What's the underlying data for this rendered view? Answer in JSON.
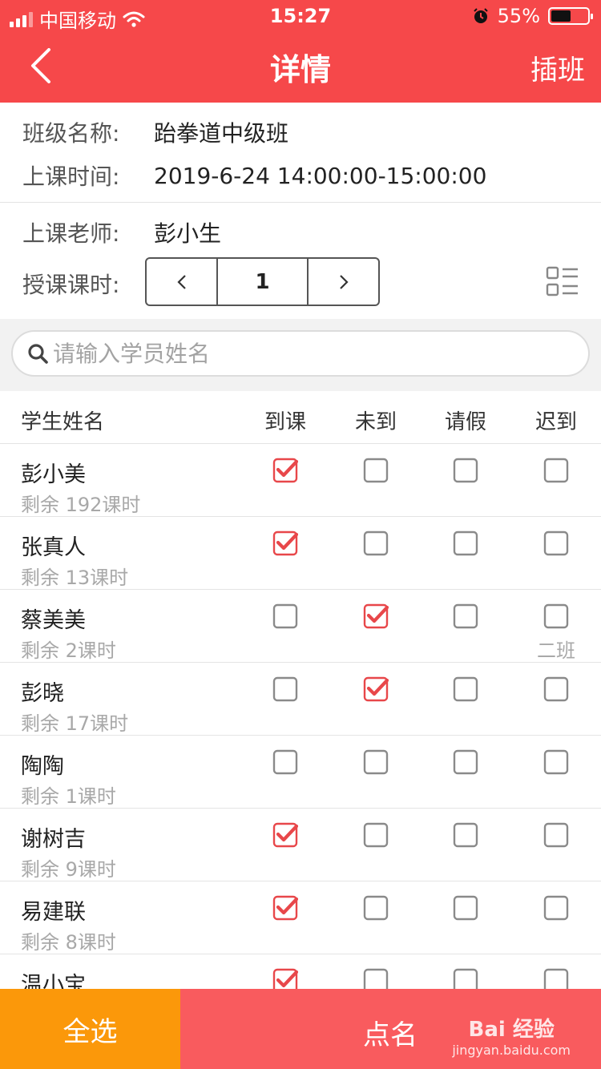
{
  "status_bar": {
    "carrier": "中国移动",
    "time": "15:27",
    "battery_percent": "55%",
    "battery_level": 0.55
  },
  "nav": {
    "title": "详情",
    "action": "插班"
  },
  "info": {
    "class_label": "班级名称:",
    "class_value": "跆拳道中级班",
    "time_label": "上课时间:",
    "time_value": "2019-6-24 14:00:00-15:00:00",
    "teacher_label": "上课老师:",
    "teacher_value": "彭小生",
    "hours_label": "授课课时:",
    "hours_value": "1"
  },
  "search": {
    "placeholder": "请输入学员姓名"
  },
  "table": {
    "headers": {
      "name": "学生姓名",
      "present": "到课",
      "absent": "未到",
      "leave": "请假",
      "late": "迟到"
    },
    "rows": [
      {
        "name": "彭小美",
        "remain": "剩余 192课时",
        "checked": "present"
      },
      {
        "name": "张真人",
        "remain": "剩余 13课时",
        "checked": "present"
      },
      {
        "name": "蔡美美",
        "remain": "剩余 2课时",
        "checked": "absent",
        "note": "二班"
      },
      {
        "name": "彭晓",
        "remain": "剩余 17课时",
        "checked": "absent"
      },
      {
        "name": "陶陶",
        "remain": "剩余 1课时",
        "checked": ""
      },
      {
        "name": "谢树吉",
        "remain": "剩余 9课时",
        "checked": "present"
      },
      {
        "name": "易建联",
        "remain": "剩余 8课时",
        "checked": "present"
      },
      {
        "name": "温小宝",
        "remain": "",
        "checked": "present"
      }
    ]
  },
  "bottom": {
    "select_all": "全选",
    "roll_call": "点名",
    "watermark_logo": "Bai 经验",
    "watermark_url": "jingyan.baidu.com"
  },
  "colors": {
    "primary": "#f6484a",
    "check": "#e8474a",
    "orange": "#fb980a"
  }
}
